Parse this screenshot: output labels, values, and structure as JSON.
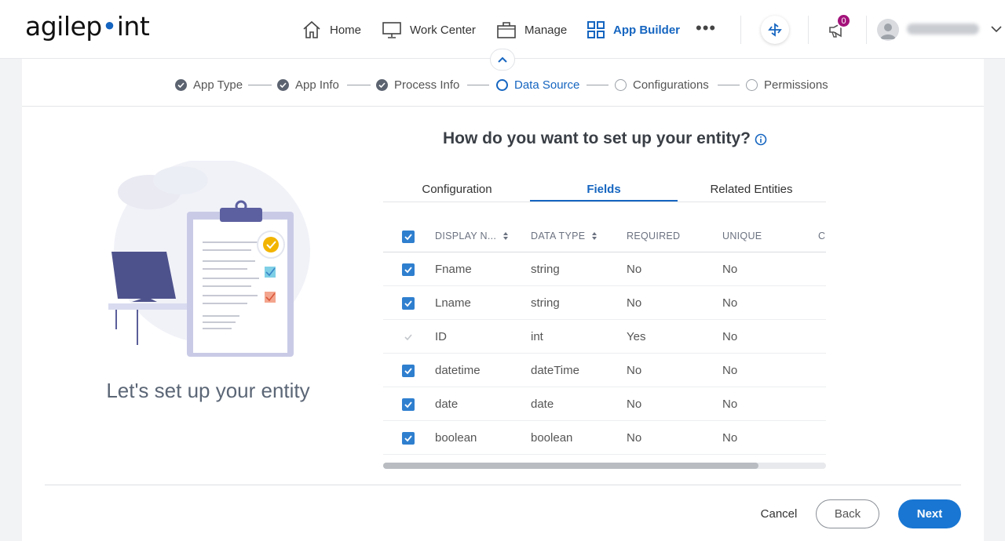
{
  "brand": {
    "logo_text_a": "agilep",
    "logo_text_b": "int"
  },
  "nav": {
    "items": [
      {
        "label": "Home",
        "icon": "home-icon"
      },
      {
        "label": "Work Center",
        "icon": "monitor-icon"
      },
      {
        "label": "Manage",
        "icon": "briefcase-icon"
      },
      {
        "label": "App Builder",
        "icon": "apps-grid-icon",
        "active": true
      }
    ],
    "notifications_count": "0",
    "user_name": "██████ ██████"
  },
  "stepper": {
    "steps": [
      {
        "label": "App Type",
        "state": "done"
      },
      {
        "label": "App Info",
        "state": "done"
      },
      {
        "label": "Process Info",
        "state": "done"
      },
      {
        "label": "Data Source",
        "state": "current"
      },
      {
        "label": "Configurations",
        "state": "todo"
      },
      {
        "label": "Permissions",
        "state": "todo"
      }
    ]
  },
  "left": {
    "title": "Let's set up your entity"
  },
  "main": {
    "question": "How do you want to set up your entity?",
    "tabs": [
      {
        "label": "Configuration"
      },
      {
        "label": "Fields",
        "active": true
      },
      {
        "label": "Related Entities"
      }
    ],
    "columns": [
      "DISPLAY N...",
      "DATA TYPE",
      "REQUIRED",
      "UNIQUE",
      "C"
    ],
    "rows": [
      {
        "name": "Fname",
        "type": "string",
        "required": "No",
        "unique": "No",
        "checked": true
      },
      {
        "name": "Lname",
        "type": "string",
        "required": "No",
        "unique": "No",
        "checked": true
      },
      {
        "name": "ID",
        "type": "int",
        "required": "Yes",
        "unique": "No",
        "checked": true,
        "disabled": true
      },
      {
        "name": "datetime",
        "type": "dateTime",
        "required": "No",
        "unique": "No",
        "checked": true
      },
      {
        "name": "date",
        "type": "date",
        "required": "No",
        "unique": "No",
        "checked": true
      },
      {
        "name": "boolean",
        "type": "boolean",
        "required": "No",
        "unique": "No",
        "checked": true
      }
    ]
  },
  "footer": {
    "cancel": "Cancel",
    "back": "Back",
    "next": "Next"
  },
  "colors": {
    "accent": "#1565c0",
    "primary_button": "#1976d2",
    "checkbox": "#2f7fcf",
    "badge": "#a3127a"
  }
}
